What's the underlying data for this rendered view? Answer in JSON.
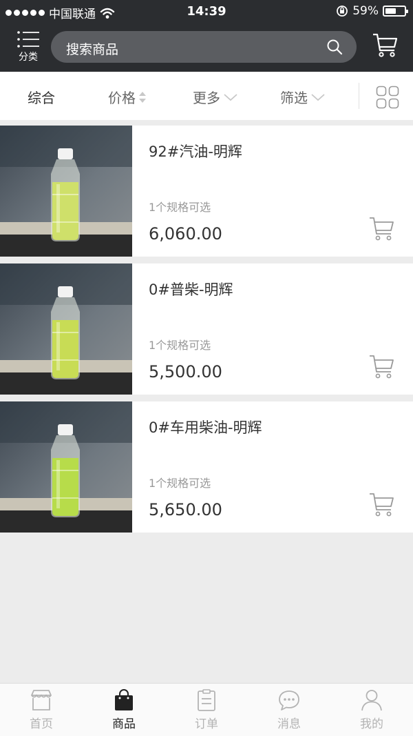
{
  "status_bar": {
    "carrier": "中国联通",
    "time": "14:39",
    "battery": "59%",
    "battery_level": 0.59
  },
  "header": {
    "category_label": "分类",
    "search_placeholder": "搜索商品",
    "icons": [
      "menu-icon",
      "search-icon",
      "cart-icon"
    ]
  },
  "sortbar": {
    "items": [
      {
        "label": "综合",
        "active": true
      },
      {
        "label": "价格",
        "indicator": "sort-updown-icon"
      },
      {
        "label": "更多",
        "indicator": "chevron-down-icon"
      },
      {
        "label": "筛选",
        "indicator": "chevron-down-icon"
      }
    ],
    "view_toggle_icon": "grid-view-icon"
  },
  "products": [
    {
      "name": "92#汽油-明辉",
      "spec": "1个规格可选",
      "price": "6,060.00",
      "liquid_color": "#cfe06a"
    },
    {
      "name": "0#普柴-明辉",
      "spec": "1个规格可选",
      "price": "5,500.00",
      "liquid_color": "#c8dc55"
    },
    {
      "name": "0#车用柴油-明辉",
      "spec": "1个规格可选",
      "price": "5,650.00",
      "liquid_color": "#b7dc4a"
    }
  ],
  "tabbar": {
    "items": [
      {
        "label": "首页",
        "icon": "store-icon",
        "active": false
      },
      {
        "label": "商品",
        "icon": "shopping-bag-icon",
        "active": true
      },
      {
        "label": "订单",
        "icon": "order-list-icon",
        "active": false
      },
      {
        "label": "消息",
        "icon": "chat-bubble-icon",
        "active": false
      },
      {
        "label": "我的",
        "icon": "user-icon",
        "active": false
      }
    ]
  }
}
